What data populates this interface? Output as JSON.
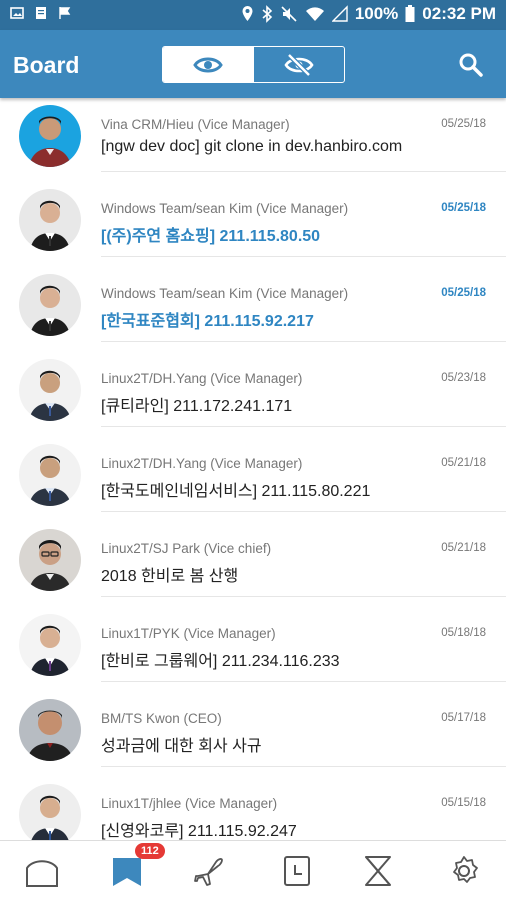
{
  "status_bar": {
    "battery": "100%",
    "time": "02:32 PM"
  },
  "app_bar": {
    "title": "Board"
  },
  "posts": [
    {
      "meta": "Vina CRM/Hieu (Vice Manager)",
      "title": "[ngw dev doc] git clone in dev.hanbiro.com",
      "date": "05/25/18",
      "highlight": false
    },
    {
      "meta": "Windows Team/sean Kim (Vice Manager)",
      "title": "[(주)주연 홈쇼핑] 211.115.80.50",
      "date": "05/25/18",
      "highlight": true
    },
    {
      "meta": "Windows Team/sean Kim (Vice Manager)",
      "title": "[한국표준협회] 211.115.92.217",
      "date": "05/25/18",
      "highlight": true
    },
    {
      "meta": "Linux2T/DH.Yang (Vice Manager)",
      "title": "[큐티라인] 211.172.241.171",
      "date": "05/23/18",
      "highlight": false
    },
    {
      "meta": "Linux2T/DH.Yang (Vice Manager)",
      "title": "[한국도메인네임서비스] 211.115.80.221",
      "date": "05/21/18",
      "highlight": false
    },
    {
      "meta": "Linux2T/SJ Park (Vice chief)",
      "title": "2018 한비로 봄 산행",
      "date": "05/21/18",
      "highlight": false
    },
    {
      "meta": "Linux1T/PYK (Vice Manager)",
      "title": "[한비로 그룹웨어] 211.234.116.233",
      "date": "05/18/18",
      "highlight": false
    },
    {
      "meta": "BM/TS Kwon (CEO)",
      "title": "성과금에 대한 회사 사규",
      "date": "05/17/18",
      "highlight": false
    },
    {
      "meta": "Linux1T/jhlee (Vice Manager)",
      "title": "[신영와코루] 211.115.92.247",
      "date": "05/15/18",
      "highlight": false
    }
  ],
  "bottom_nav": {
    "items": [
      "home-icon",
      "board-icon",
      "plane-icon",
      "calendar-icon",
      "approval-icon",
      "settings-icon"
    ],
    "board_badge": "112",
    "active": "board-icon"
  },
  "colors": {
    "status_bar": "#2f6f9c",
    "app_bar": "#3d88bd",
    "accent": "#2f86c2",
    "badge": "#e53935"
  }
}
